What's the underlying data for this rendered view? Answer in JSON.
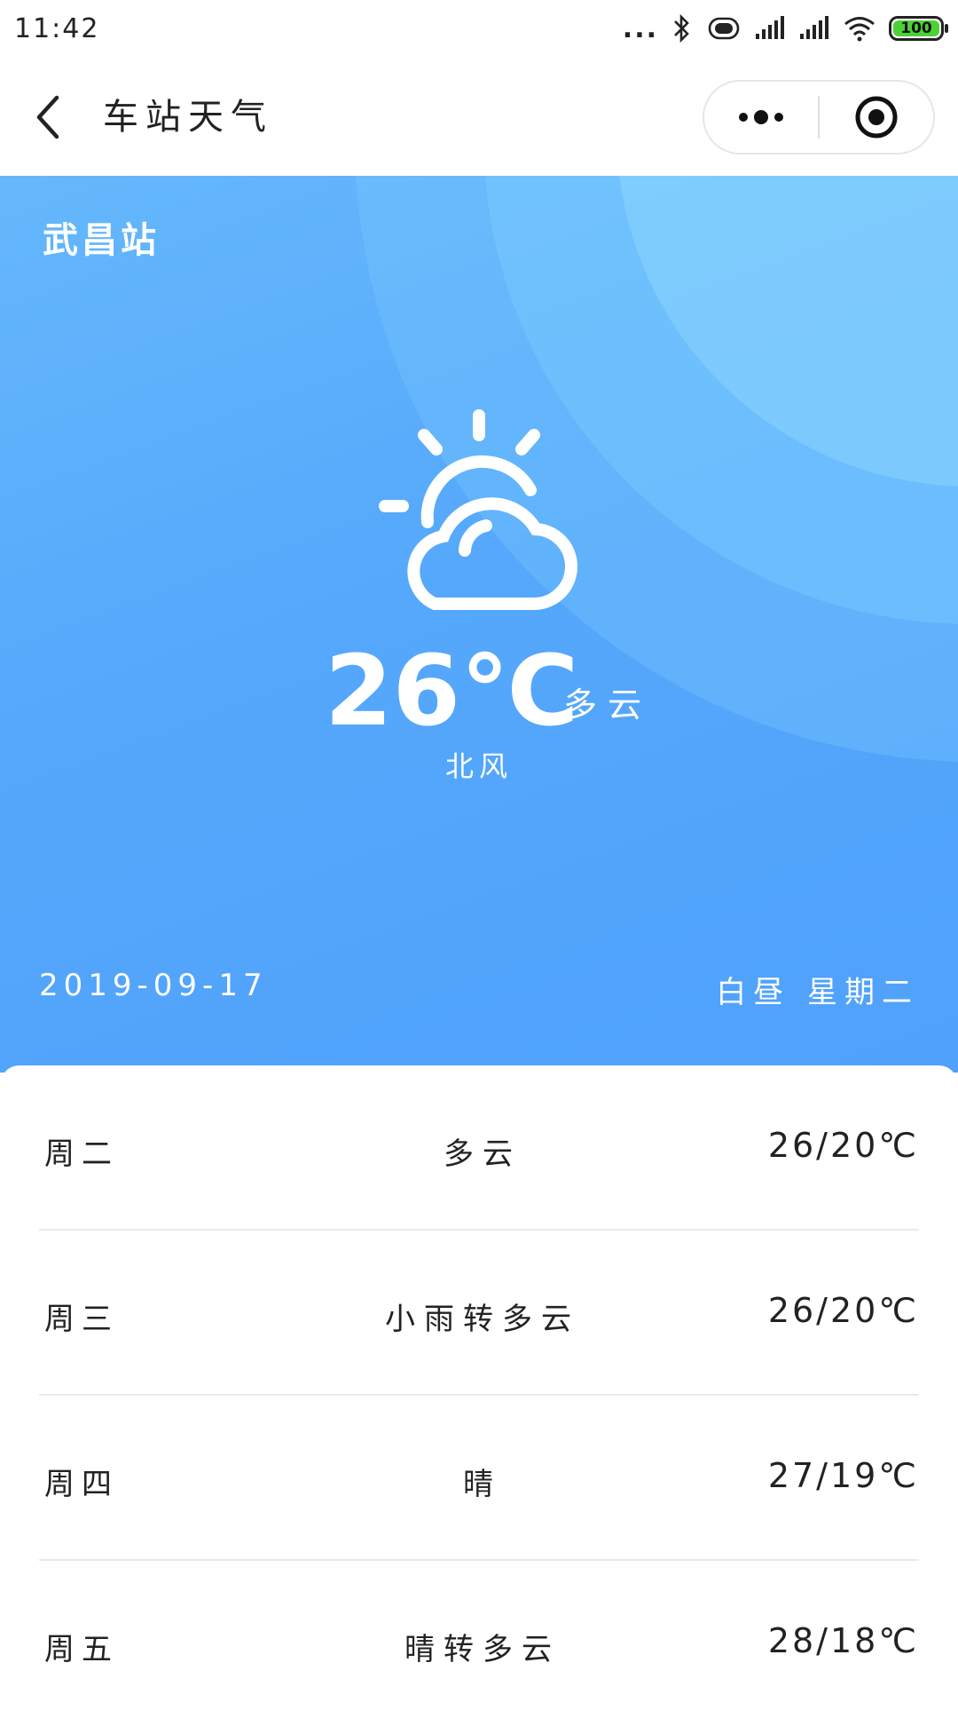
{
  "status": {
    "time": "11:42",
    "signal_dots": "...",
    "battery_level": "100"
  },
  "nav": {
    "title": "车站天气"
  },
  "hero": {
    "station": "武昌站",
    "temperature": "26℃",
    "condition": "多云",
    "wind": "北风",
    "date": "2019-09-17",
    "period": "白昼 星期二",
    "icon": "partly-cloudy-icon"
  },
  "forecast": [
    {
      "day": "周二",
      "condition": "多云",
      "range": "26/20℃"
    },
    {
      "day": "周三",
      "condition": "小雨转多云",
      "range": "26/20℃"
    },
    {
      "day": "周四",
      "condition": "晴",
      "range": "27/19℃"
    },
    {
      "day": "周五",
      "condition": "晴转多云",
      "range": "28/18℃"
    }
  ],
  "colors": {
    "hero_gradient_start": "#65b8fb",
    "hero_gradient_end": "#4fa1fb",
    "battery": "#4cd137"
  }
}
